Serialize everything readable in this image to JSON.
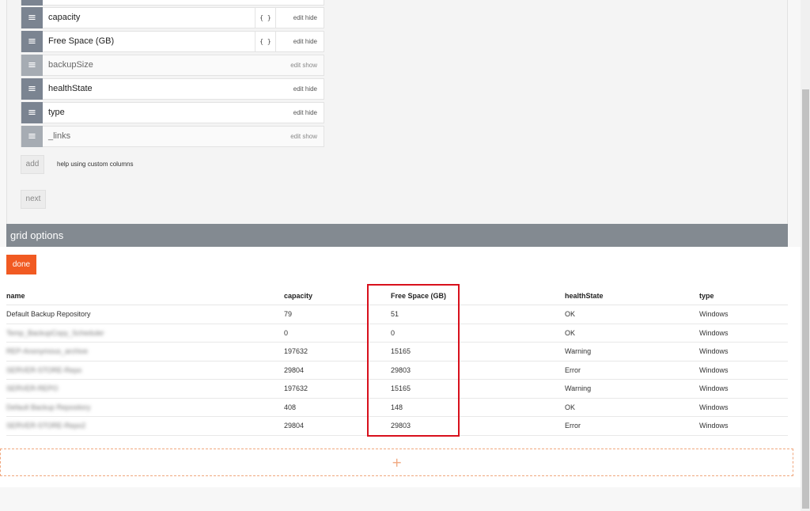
{
  "columns_config": {
    "rows": [
      {
        "label": "capacity",
        "has_brace": true,
        "brace": "{ }",
        "actions": "edit hide",
        "hidden": false
      },
      {
        "label": "Free Space (GB)",
        "has_brace": true,
        "brace": "{ }",
        "actions": "edit hide",
        "hidden": false
      },
      {
        "label": "backupSize",
        "has_brace": false,
        "actions": "edit show",
        "hidden": true
      },
      {
        "label": "healthState",
        "has_brace": false,
        "actions": "edit hide",
        "hidden": false
      },
      {
        "label": "type",
        "has_brace": false,
        "actions": "edit hide",
        "hidden": false
      },
      {
        "label": "_links",
        "has_brace": false,
        "actions": "edit show",
        "hidden": true
      }
    ],
    "add_label": "add",
    "help_text": "help using custom columns",
    "next_label": "next",
    "handle_icon": "drag-handle-icon",
    "handle_glyph": "≡"
  },
  "grid_options": {
    "title": "grid options",
    "done_label": "done"
  },
  "grid": {
    "headers": [
      "name",
      "capacity",
      "Free Space (GB)",
      "healthState",
      "type"
    ],
    "rows": [
      {
        "name": "Default Backup Repository",
        "capacity": "79",
        "free": "51",
        "health": "OK",
        "type": "Windows"
      },
      {
        "name": "Temp_BackupCopy_Scheduler",
        "capacity": "0",
        "free": "0",
        "health": "OK",
        "type": "Windows"
      },
      {
        "name": "REP-Anonymous_archive",
        "capacity": "197632",
        "free": "15165",
        "health": "Warning",
        "type": "Windows"
      },
      {
        "name": "SERVER-STORE-Repo",
        "capacity": "29804",
        "free": "29803",
        "health": "Error",
        "type": "Windows"
      },
      {
        "name": "SERVER-REPO",
        "capacity": "197632",
        "free": "15165",
        "health": "Warning",
        "type": "Windows"
      },
      {
        "name": "Default Backup Repository",
        "capacity": "408",
        "free": "148",
        "health": "OK",
        "type": "Windows"
      },
      {
        "name": "SERVER-STORE-Repo2",
        "capacity": "29804",
        "free": "29803",
        "health": "Error",
        "type": "Windows"
      }
    ]
  },
  "add_zone": {
    "plus": "+"
  },
  "colors": {
    "accent": "#f15a22",
    "handle": "#7b8491",
    "header_bar": "#838a91",
    "highlight": "#d8101c"
  }
}
